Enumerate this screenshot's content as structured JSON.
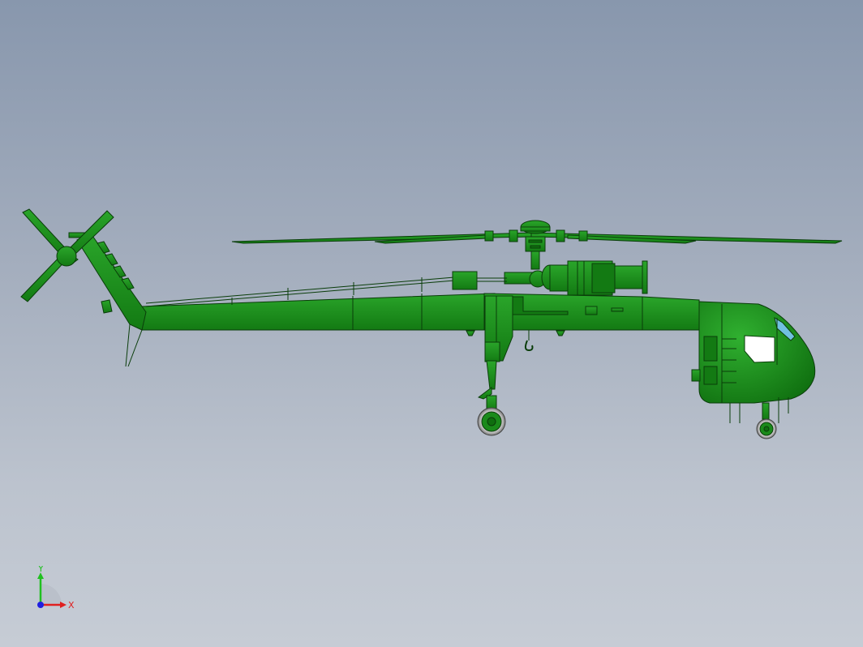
{
  "viewport": {
    "background_top": "#8897ad",
    "background_bottom": "#c6ccd5"
  },
  "model": {
    "body_color": "#1a8a1a",
    "outline_color": "#0a3d0a"
  },
  "triad": {
    "x_label": "X",
    "y_label": "Y",
    "x_color": "#e02020",
    "y_color": "#20c020",
    "z_color": "#2020e0"
  }
}
